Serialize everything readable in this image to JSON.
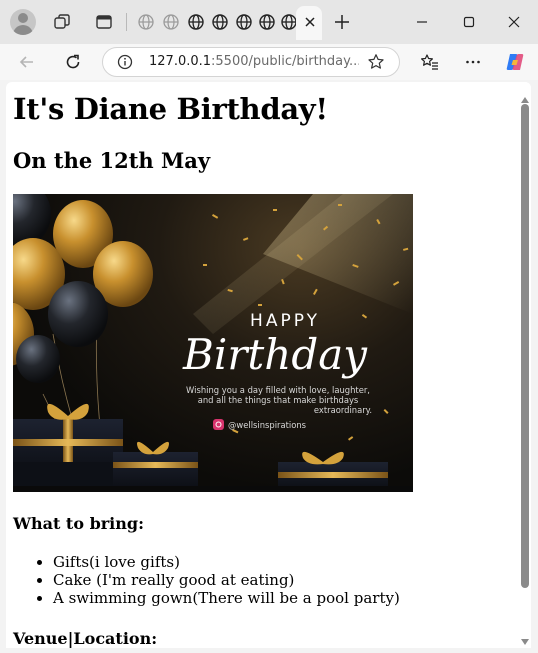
{
  "browser": {
    "address_bar": {
      "url_host": "127.0.0.1",
      "url_path": ":5500/public/birthday..."
    },
    "tabs": {
      "mini_tab_count": 7
    }
  },
  "page": {
    "title": "It's Diane Birthday!",
    "subtitle": "On the 12th May",
    "hero_image": {
      "happy": "HAPPY",
      "birthday": "Birthday",
      "wish_line_1": "Wishing you a day filled with love, laughter,",
      "wish_line_2": "and all the things that make birthdays",
      "wish_line_3": "extraordinary.",
      "credit": "@wellsinspirations"
    },
    "bring_heading": "What to bring:",
    "bring_items": [
      "Gifts(i love gifts)",
      "Cake (I'm really good at eating)",
      "A swimming gown(There will be a pool party)"
    ],
    "venue_heading": "Venue|Location:"
  },
  "colors": {
    "chrome_bg": "#e6e6e6",
    "toolbar_bg": "#f7f7f7",
    "gold": "#d4a23c",
    "copilot_blue": "#2f7cf6",
    "copilot_pink": "#e0497a"
  }
}
